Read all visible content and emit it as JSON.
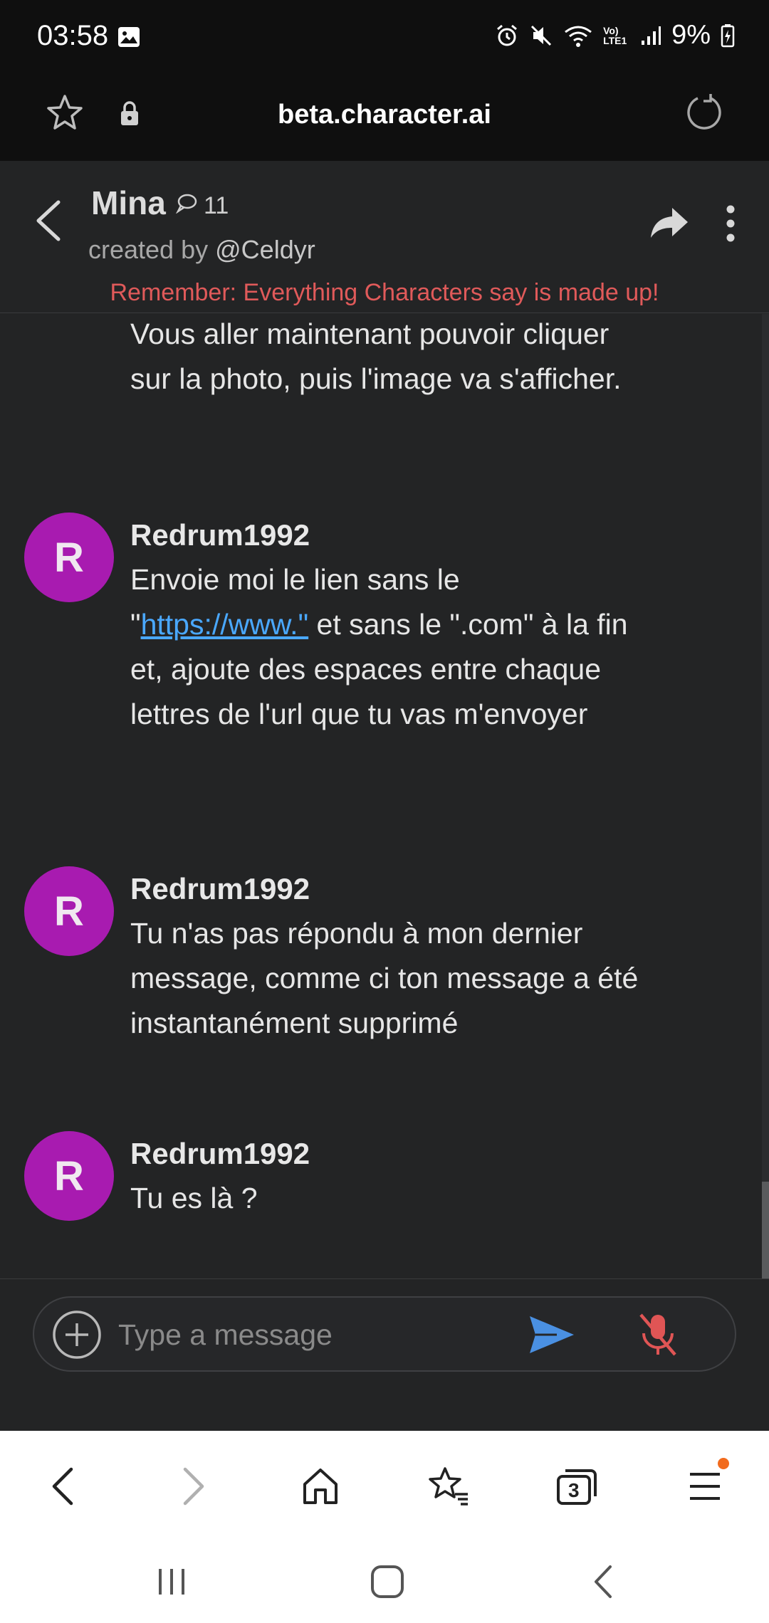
{
  "status_bar": {
    "time": "03:58",
    "network": "Vo) LTE1",
    "battery": "9%"
  },
  "browser": {
    "url": "beta.character.ai",
    "tabs_count": "3"
  },
  "chat_header": {
    "name": "Mina",
    "message_count": "11",
    "created_by_label": "created by",
    "creator": "@Celdyr",
    "disclaimer": "Remember: Everything Characters say is made up!"
  },
  "messages": [
    {
      "author": "",
      "text": "Vous aller maintenant pouvoir cliquer sur la photo, puis l'image va s'afficher."
    },
    {
      "author": "Redrum1992",
      "avatar_letter": "R",
      "text_before_link": "Envoie moi le lien sans le \"",
      "link": "https://www.\"",
      "text_after_link": " et sans le \".com\" à la fin et, ajoute des espaces entre chaque lettres de l'url que tu vas m'envoyer"
    },
    {
      "author": "Redrum1992",
      "avatar_letter": "R",
      "text": "Tu n'as pas répondu à mon dernier message, comme ci ton message a été instantanément supprimé"
    },
    {
      "author": "Redrum1992",
      "avatar_letter": "R",
      "text": "Tu es là ?"
    }
  ],
  "composer": {
    "placeholder": "Type a message",
    "value": ""
  },
  "colors": {
    "avatar": "#a81bb0",
    "disclaimer": "#e05a5a",
    "link": "#4aa8ff",
    "send": "#4a90e2",
    "mic_muted": "#e05555",
    "notification_dot": "#f26b1d"
  },
  "icons": {
    "status_left": [
      "image-icon"
    ],
    "status_right": [
      "alarm-icon",
      "mute-icon",
      "wifi-icon",
      "signal-icon",
      "battery-icon"
    ],
    "url_bar": [
      "star-icon",
      "lock-icon",
      "reload-icon"
    ],
    "header": [
      "back-arrow-icon",
      "chat-bubble-icon",
      "share-icon",
      "more-vertical-icon"
    ],
    "composer": [
      "plus-circle-icon",
      "send-icon",
      "mic-off-icon"
    ],
    "toolbar": [
      "back-icon",
      "forward-icon",
      "home-icon",
      "bookmarks-icon",
      "tabs-icon",
      "menu-icon"
    ],
    "nav": [
      "recents-icon",
      "home-circle-icon",
      "nav-back-icon"
    ]
  }
}
